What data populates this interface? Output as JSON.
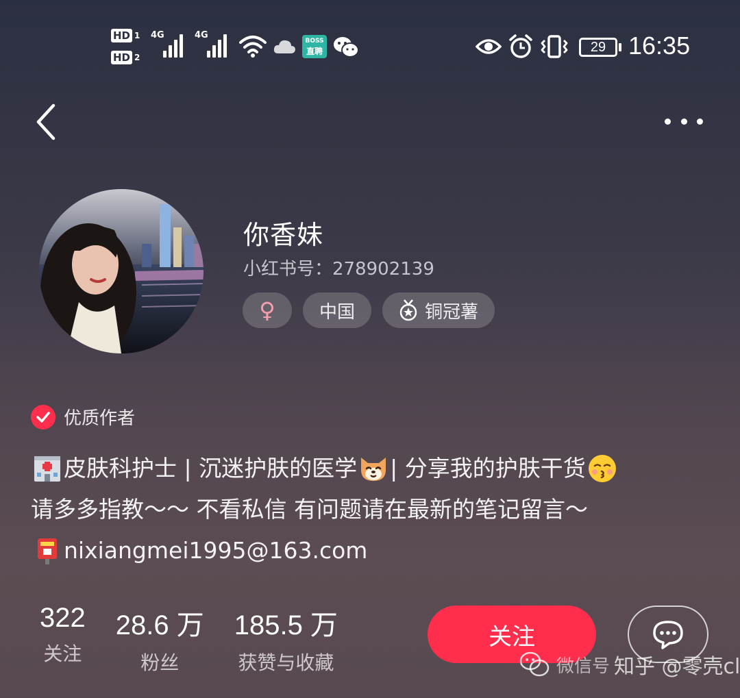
{
  "status_bar": {
    "hd1": "HD",
    "hd1_n": "1",
    "hd2": "HD",
    "hd2_n": "2",
    "net1": "4G",
    "net2": "4G",
    "boss_top": "BOSS",
    "boss_bottom": "直聘",
    "battery": "29",
    "time": "16:35"
  },
  "profile": {
    "name": "你香妹",
    "red_id": "小红书号：278902139",
    "tags": {
      "gender_symbol": "♀",
      "region": "中国",
      "level": "铜冠薯"
    },
    "badge": "优质作者",
    "bio": {
      "line1_a": "皮肤科护士 | 沉迷护肤的医学",
      "line1_b": " | 分享我的护肤干货",
      "line2": "请多多指教～～ 不看私信 有问题请在最新的笔记留言～",
      "line3": "nixiangmei1995@163.com"
    }
  },
  "stats": [
    {
      "value": "322",
      "label": "关注"
    },
    {
      "value": "28.6 万",
      "label": "粉丝"
    },
    {
      "value": "185.5 万",
      "label": "获赞与收藏"
    }
  ],
  "actions": {
    "follow": "关注"
  },
  "watermark": {
    "text": "知乎 @零壳club",
    "overlay": "微信号"
  },
  "colors": {
    "accent": "#ff2e4d",
    "gender": "#f7a0b0"
  }
}
